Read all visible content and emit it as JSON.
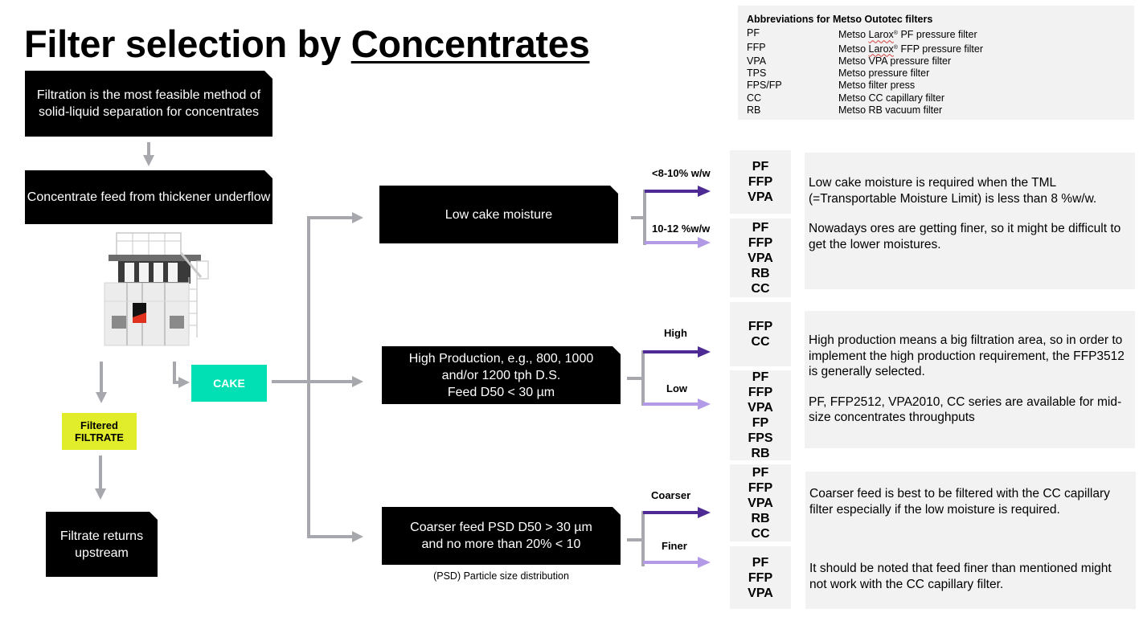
{
  "title": {
    "prefix": "Filter selection by ",
    "emphasis": "Concentrates"
  },
  "abbreviations": {
    "heading": "Abbreviations for Metso Outotec filters",
    "items": [
      {
        "code": "PF",
        "pre": "Metso ",
        "squiggle": "Larox",
        "reg": "®",
        "post": " PF pressure filter"
      },
      {
        "code": "FFP",
        "pre": "Metso ",
        "squiggle": "Larox",
        "reg": "®",
        "post": " FFP pressure filter"
      },
      {
        "code": "VPA",
        "pre": "Metso VPA pressure filter",
        "squiggle": "",
        "reg": "",
        "post": ""
      },
      {
        "code": "TPS",
        "pre": "Metso pressure filter",
        "squiggle": "",
        "reg": "",
        "post": ""
      },
      {
        "code": "FPS/FP",
        "pre": "Metso filter press",
        "squiggle": "",
        "reg": "",
        "post": ""
      },
      {
        "code": "CC",
        "pre": "Metso CC capillary filter",
        "squiggle": "",
        "reg": "",
        "post": ""
      },
      {
        "code": "RB",
        "pre": "Metso RB vacuum filter",
        "squiggle": "",
        "reg": "",
        "post": ""
      }
    ]
  },
  "flow": {
    "filtration": "Filtration is the most feasible method of solid-liquid separation for concentrates",
    "feed": "Concentrate feed from thickener underflow",
    "machine_image": "Metso filter machine illustration",
    "cake": "CAKE",
    "filtrate": {
      "line1": "Filtered",
      "line2": "FILTRATE"
    },
    "filtrate_return": "Filtrate returns upstream"
  },
  "branches": [
    {
      "condition": "Low cake moisture",
      "options": [
        {
          "label": "<8-10% w/w",
          "filters": [
            "PF",
            "FFP",
            "VPA"
          ]
        },
        {
          "label": "10-12 %w/w",
          "filters": [
            "PF",
            "FFP",
            "VPA",
            "RB",
            "CC"
          ]
        }
      ],
      "notes": [
        "Low cake moisture is required when the TML (=Transportable Moisture Limit) is less than 8 %w/w.",
        "Nowadays ores are getting finer, so it might be difficult to get the lower moistures."
      ]
    },
    {
      "condition_lines": [
        "High Production, e.g., 800, 1000",
        "and/or 1200 tph D.S.",
        "Feed D50 < 30 µm"
      ],
      "options": [
        {
          "label": "High",
          "filters": [
            "FFP",
            "CC"
          ]
        },
        {
          "label": "Low",
          "filters": [
            "PF",
            "FFP",
            "VPA",
            "FP",
            "FPS",
            "RB"
          ]
        }
      ],
      "notes": [
        "High production means a big filtration area, so in order to implement the high production requirement, the FFP3512 is generally selected.",
        "PF, FFP2512, VPA2010, CC series are available for mid-size concentrates throughputs"
      ]
    },
    {
      "condition_lines": [
        "Coarser feed PSD D50 > 30 µm",
        "and no more than 20% < 10"
      ],
      "footnote": "(PSD) Particle size distribution",
      "options": [
        {
          "label": "Coarser",
          "filters": [
            "PF",
            "FFP",
            "VPA",
            "RB",
            "CC"
          ]
        },
        {
          "label": "Finer",
          "filters": [
            "PF",
            "FFP",
            "VPA"
          ]
        }
      ],
      "notes": [
        "Coarser feed is best to be filtered with the CC capillary filter especially if the low moisture is required.",
        "It should be noted that feed finer than mentioned might not work with the CC capillary filter."
      ]
    }
  ],
  "colors": {
    "arrow_gray": "#a6a8ad",
    "arrow_dark_purple": "#4e2a94",
    "arrow_light_purple": "#b39ae6",
    "cake": "#00e0b4",
    "filtrate": "#e1ed2a",
    "panel_gray": "#f2f2f2"
  }
}
